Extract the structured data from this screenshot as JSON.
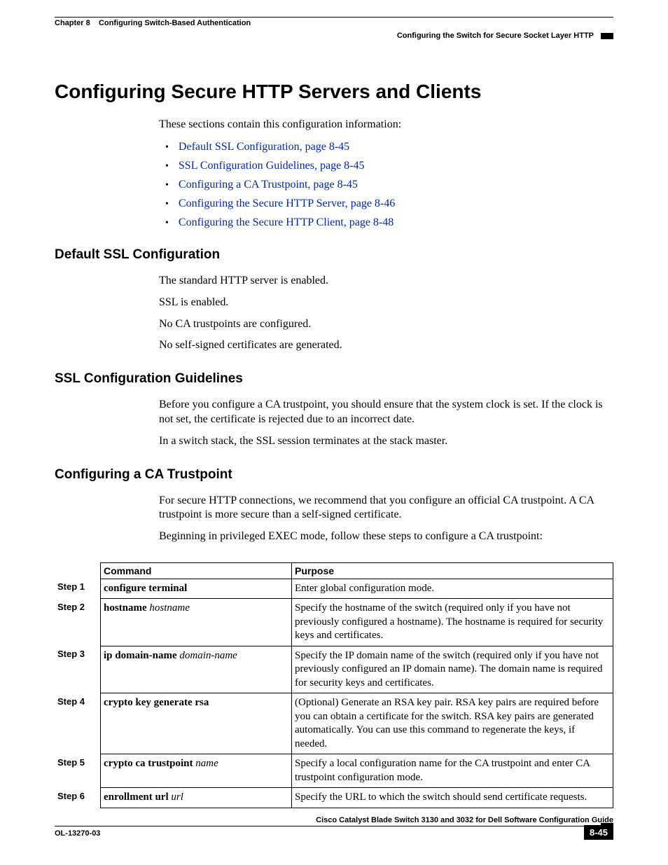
{
  "header": {
    "chapter_label": "Chapter 8",
    "chapter_title": "Configuring Switch-Based Authentication",
    "section_path": "Configuring the Switch for Secure Socket Layer HTTP"
  },
  "title": "Configuring Secure HTTP Servers and Clients",
  "intro": "These sections contain this configuration information:",
  "toc": [
    "Default SSL Configuration, page 8-45",
    "SSL Configuration Guidelines, page 8-45",
    "Configuring a CA Trustpoint, page 8-45",
    "Configuring the Secure HTTP Server, page 8-46",
    "Configuring the Secure HTTP Client, page 8-48"
  ],
  "sections": {
    "default_ssl": {
      "heading": "Default SSL Configuration",
      "paras": [
        "The standard HTTP server is enabled.",
        "SSL is enabled.",
        "No CA trustpoints are configured.",
        "No self-signed certificates are generated."
      ]
    },
    "guidelines": {
      "heading": "SSL Configuration Guidelines",
      "paras": [
        "Before you configure a CA trustpoint, you should ensure that the system clock is set. If the clock is not set, the certificate is rejected due to an incorrect date.",
        "In a switch stack, the SSL session terminates at the stack master."
      ]
    },
    "trustpoint": {
      "heading": "Configuring a CA Trustpoint",
      "paras": [
        "For secure HTTP connections, we recommend that you configure an official CA trustpoint. A CA trustpoint is more secure than a self-signed certificate.",
        "Beginning in privileged EXEC mode, follow these steps to configure a CA trustpoint:"
      ]
    }
  },
  "table": {
    "headers": {
      "command": "Command",
      "purpose": "Purpose"
    },
    "rows": [
      {
        "step": "Step 1",
        "cmd_bold": "configure terminal",
        "cmd_italic": "",
        "purpose": "Enter global configuration mode."
      },
      {
        "step": "Step 2",
        "cmd_bold": "hostname",
        "cmd_italic": "hostname",
        "purpose": "Specify the hostname of the switch (required only if you have not previously configured a hostname). The hostname is required for security keys and certificates."
      },
      {
        "step": "Step 3",
        "cmd_bold": "ip domain-name",
        "cmd_italic": "domain-name",
        "purpose": "Specify the IP domain name of the switch (required only if you have not previously configured an IP domain name). The domain name is required for security keys and certificates."
      },
      {
        "step": "Step 4",
        "cmd_bold": "crypto key generate rsa",
        "cmd_italic": "",
        "purpose": "(Optional) Generate an RSA key pair. RSA key pairs are required before you can obtain a certificate for the switch. RSA key pairs are generated automatically. You can use this command to regenerate the keys, if needed."
      },
      {
        "step": "Step 5",
        "cmd_bold": "crypto ca trustpoint",
        "cmd_italic": "name",
        "purpose": "Specify a local configuration name for the CA trustpoint and enter CA trustpoint configuration mode."
      },
      {
        "step": "Step 6",
        "cmd_bold": "enrollment url",
        "cmd_italic": "url",
        "purpose": "Specify the URL to which the switch should send certificate requests."
      }
    ]
  },
  "footer": {
    "book_title": "Cisco Catalyst Blade Switch 3130 and 3032 for Dell Software Configuration Guide",
    "doc_id": "OL-13270-03",
    "page_number": "8-45"
  }
}
